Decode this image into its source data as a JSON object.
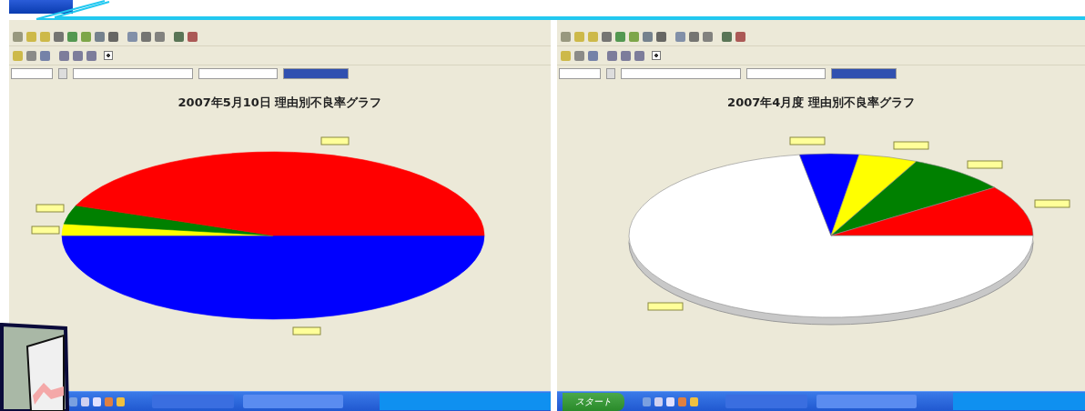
{
  "windows": [
    {
      "title_bar_visible": true,
      "checkbox": {
        "checked": true
      },
      "chart": {
        "title": "2007年5月10日 理由別不良率グラフ",
        "kind": "flat",
        "slices": [
          {
            "color": "#0000ff"
          },
          {
            "color": "#ffff00"
          },
          {
            "color": "#008000"
          },
          {
            "color": "#ff0000"
          }
        ]
      }
    },
    {
      "checkbox": {
        "checked": true
      },
      "chart": {
        "title": "2007年4月度 理由別不良率グラフ",
        "kind": "tilted",
        "slices": [
          {
            "color": "#ffffff"
          },
          {
            "color": "#0000ff"
          },
          {
            "color": "#ffff00"
          },
          {
            "color": "#008000"
          },
          {
            "color": "#ff0000"
          }
        ]
      },
      "start_button": {
        "label": "スタート"
      }
    }
  ]
}
